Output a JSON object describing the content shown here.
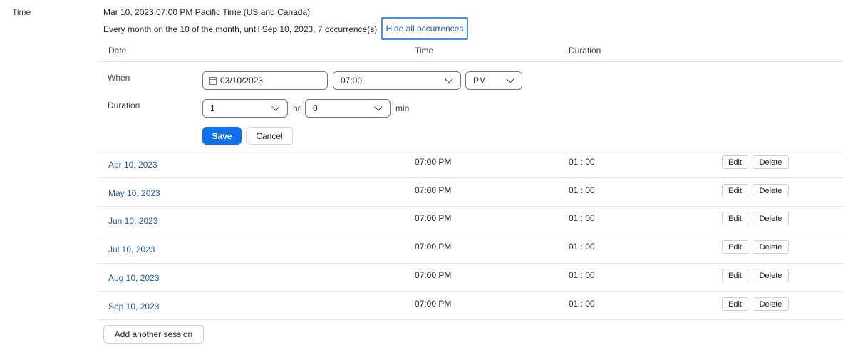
{
  "field_label": "Time",
  "summary": "Mar 10, 2023 07:00 PM Pacific Time (US and Canada)",
  "recurrence": "Every month on the 10 of the month, until Sep 10, 2023, 7 occurrence(s)",
  "hide_link": "Hide all occurrences",
  "columns": {
    "date": "Date",
    "time": "Time",
    "duration": "Duration"
  },
  "edit_form": {
    "when_label": "When",
    "date_value": "03/10/2023",
    "time_value": "07:00",
    "ampm_value": "PM",
    "duration_label": "Duration",
    "hours_value": "1",
    "hours_unit": "hr",
    "minutes_value": "0",
    "minutes_unit": "min",
    "save_label": "Save",
    "cancel_label": "Cancel"
  },
  "occurrences": [
    {
      "date": "Apr 10, 2023",
      "time": "07:00 PM",
      "duration": "01 : 00"
    },
    {
      "date": "May 10, 2023",
      "time": "07:00 PM",
      "duration": "01 : 00"
    },
    {
      "date": "Jun 10, 2023",
      "time": "07:00 PM",
      "duration": "01 : 00"
    },
    {
      "date": "Jul 10, 2023",
      "time": "07:00 PM",
      "duration": "01 : 00"
    },
    {
      "date": "Aug 10, 2023",
      "time": "07:00 PM",
      "duration": "01 : 00"
    },
    {
      "date": "Sep 10, 2023",
      "time": "07:00 PM",
      "duration": "01 : 00"
    }
  ],
  "row_actions": {
    "edit": "Edit",
    "delete": "Delete"
  },
  "add_session_label": "Add another session",
  "colors": {
    "link": "#1f5aa8",
    "primary": "#0e71eb",
    "focus": "#4a8ef0"
  }
}
